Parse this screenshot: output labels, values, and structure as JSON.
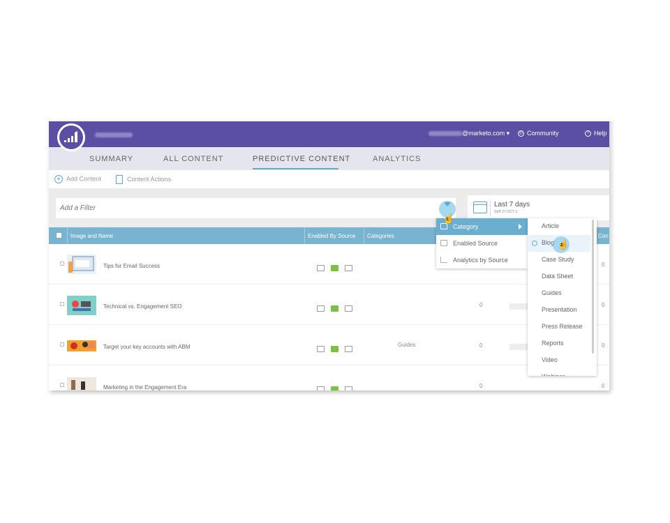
{
  "header": {
    "email_suffix": "@marketo.com",
    "community_label": "Community",
    "help_label": "Help"
  },
  "tabs": [
    {
      "label": "SUMMARY",
      "active": false
    },
    {
      "label": "ALL CONTENT",
      "active": false
    },
    {
      "label": "PREDICTIVE CONTENT",
      "active": true
    },
    {
      "label": "ANALYTICS",
      "active": false
    }
  ],
  "actions": {
    "add_content": "Add Content",
    "content_actions": "Content Actions"
  },
  "filter": {
    "placeholder": "Add a Filter"
  },
  "date_range": {
    "title": "Last 7 days",
    "subtitle": "SEP 27-OCT 3"
  },
  "table": {
    "columns": [
      "Image and Name",
      "Enabled By Source",
      "Categories",
      "Con"
    ],
    "rows": [
      {
        "name": "Tips for Email Success",
        "category": "",
        "count": "",
        "last": "0",
        "sources": [
          "email",
          "web",
          "mobile"
        ]
      },
      {
        "name": "Technical vs. Engagement SEO",
        "category": "",
        "count": "0",
        "last": "0",
        "sources": [
          "email",
          "web",
          "mobile"
        ]
      },
      {
        "name": "Target your key accounts with ABM",
        "category": "Guides",
        "count": "0",
        "last": "0",
        "sources": [
          "email",
          "web",
          "mobile"
        ]
      },
      {
        "name": "Marketing in the Engagement Era",
        "category": "",
        "count": "0",
        "last": "0",
        "sources": [
          "email",
          "web",
          "mobile"
        ]
      }
    ]
  },
  "filter_menu": {
    "items": [
      {
        "label": "Category",
        "highlighted": true
      },
      {
        "label": "Enabled Source",
        "highlighted": false
      },
      {
        "label": "Analytics by Source",
        "highlighted": false
      }
    ]
  },
  "category_menu": {
    "items": [
      {
        "label": "Article"
      },
      {
        "label": "Blog",
        "hovered": true
      },
      {
        "label": "Case Study"
      },
      {
        "label": "Data Sheet"
      },
      {
        "label": "Guides"
      },
      {
        "label": "Presentation"
      },
      {
        "label": "Press Release"
      },
      {
        "label": "Reports"
      },
      {
        "label": "Video"
      },
      {
        "label": "Webinar"
      }
    ]
  },
  "cursors": [
    {
      "step": "1"
    },
    {
      "step": "2"
    }
  ],
  "colors": {
    "header": "#5a4fa3",
    "accent": "#5bb0d0",
    "table_header": "#78b3cf",
    "source_green": "#7cc242"
  }
}
